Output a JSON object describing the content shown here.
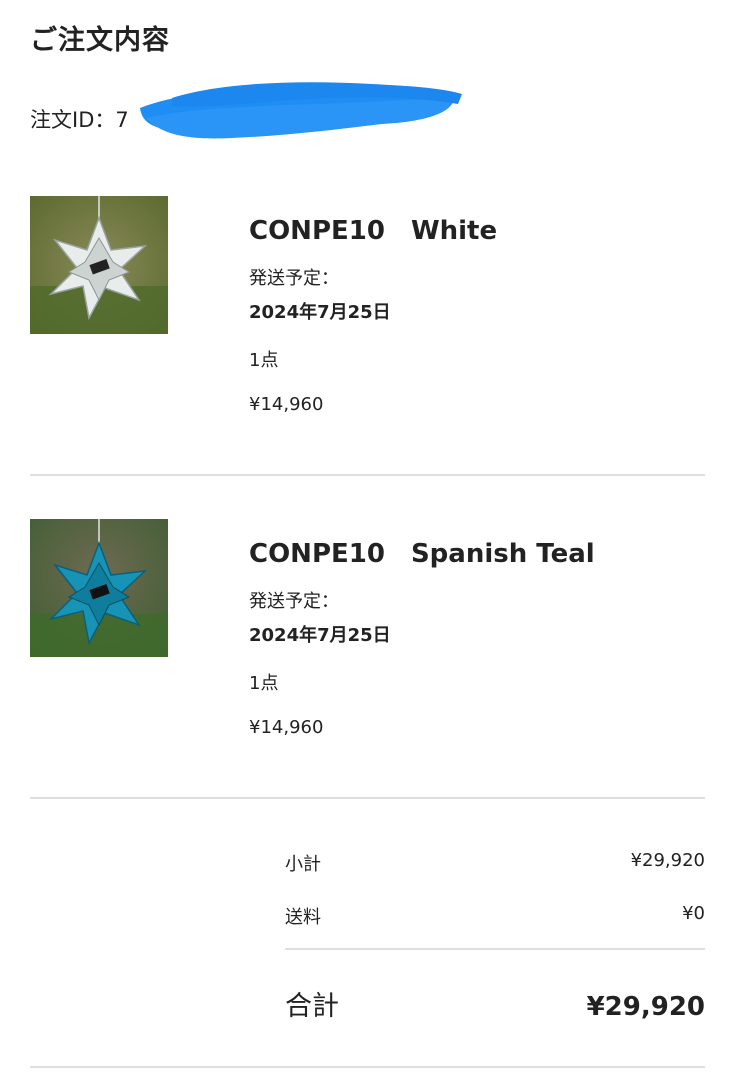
{
  "page_title": "ご注文内容",
  "order": {
    "id_label": "注文ID：",
    "id_visible": "7"
  },
  "items": [
    {
      "name": "CONPE10　White",
      "ship_label": "発送予定：",
      "ship_date": "2024年7月25日",
      "quantity": "1点",
      "price": "¥14,960",
      "thumb_icon": "white-star-ornament-photo",
      "thumb_color": "#e6e9e8"
    },
    {
      "name": "CONPE10　Spanish Teal",
      "ship_label": "発送予定：",
      "ship_date": "2024年7月25日",
      "quantity": "1点",
      "price": "¥14,960",
      "thumb_icon": "teal-star-ornament-photo",
      "thumb_color": "#1793b5"
    }
  ],
  "summary": {
    "subtotal_label": "小計",
    "subtotal_value": "¥29,920",
    "shipping_label": "送料",
    "shipping_value": "¥0",
    "total_label": "合計",
    "total_value": "¥29,920"
  },
  "redaction_color": "#1e90ff"
}
